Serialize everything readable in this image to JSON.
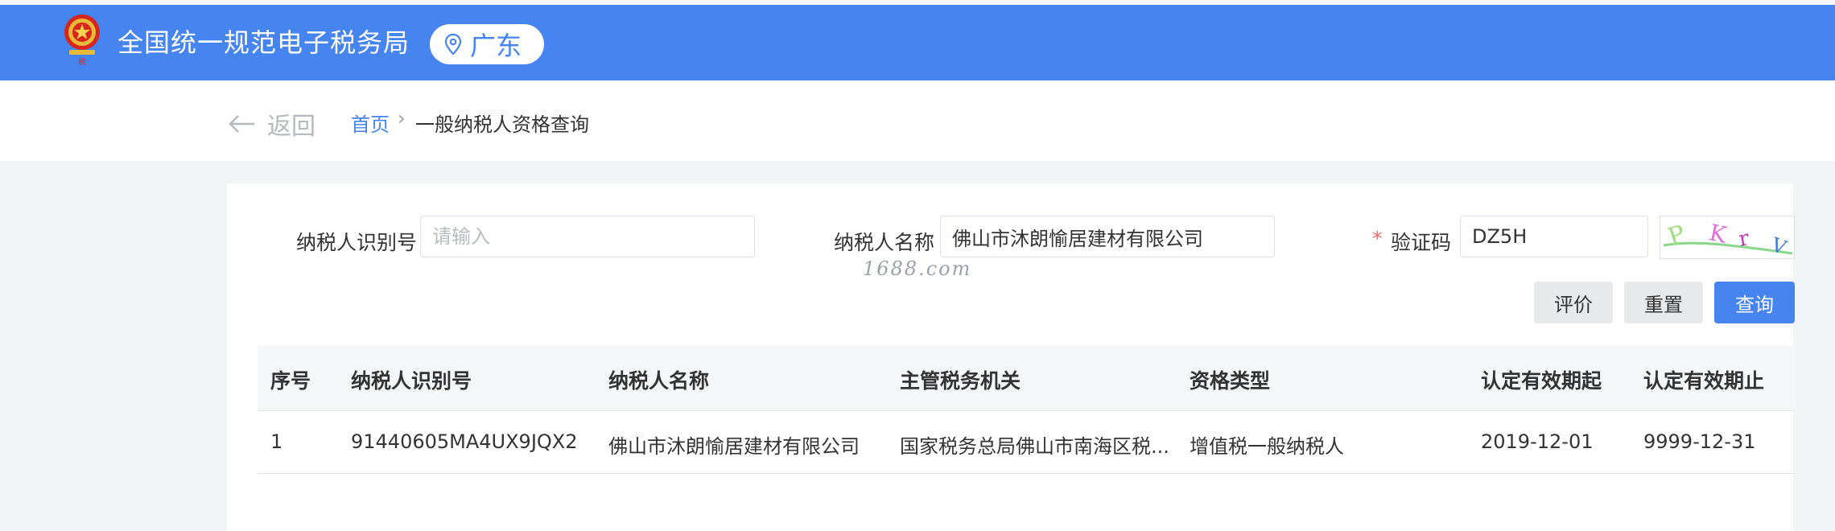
{
  "header": {
    "site_title": "全国统一规范电子税务局",
    "region": "广东",
    "brand_color": "#4684f0"
  },
  "nav": {
    "back_label": "返回",
    "breadcrumb_home": "首页",
    "breadcrumb_separator": "›",
    "breadcrumb_current": "一般纳税人资格查询"
  },
  "form": {
    "taxpayer_id_label": "纳税人识别号",
    "taxpayer_id_placeholder": "请输入",
    "taxpayer_id_value": "",
    "taxpayer_name_label": "纳税人名称",
    "taxpayer_name_value": "佛山市沐朗愉居建材有限公司",
    "required_mark": "*",
    "captcha_label": "验证码",
    "captcha_value": "DZ5H",
    "captcha_image_text": "PKrV",
    "watermark": "1688.com"
  },
  "actions": {
    "evaluate": "评价",
    "reset": "重置",
    "query": "查询"
  },
  "table": {
    "columns": [
      "序号",
      "纳税人识别号",
      "纳税人名称",
      "主管税务机关",
      "资格类型",
      "认定有效期起",
      "认定有效期止"
    ],
    "rows": [
      [
        "1",
        "91440605MA4UX9JQX2",
        "佛山市沐朗愉居建材有限公司",
        "国家税务总局佛山市南海区税...",
        "增值税一般纳税人",
        "2019-12-01",
        "9999-12-31"
      ]
    ]
  }
}
